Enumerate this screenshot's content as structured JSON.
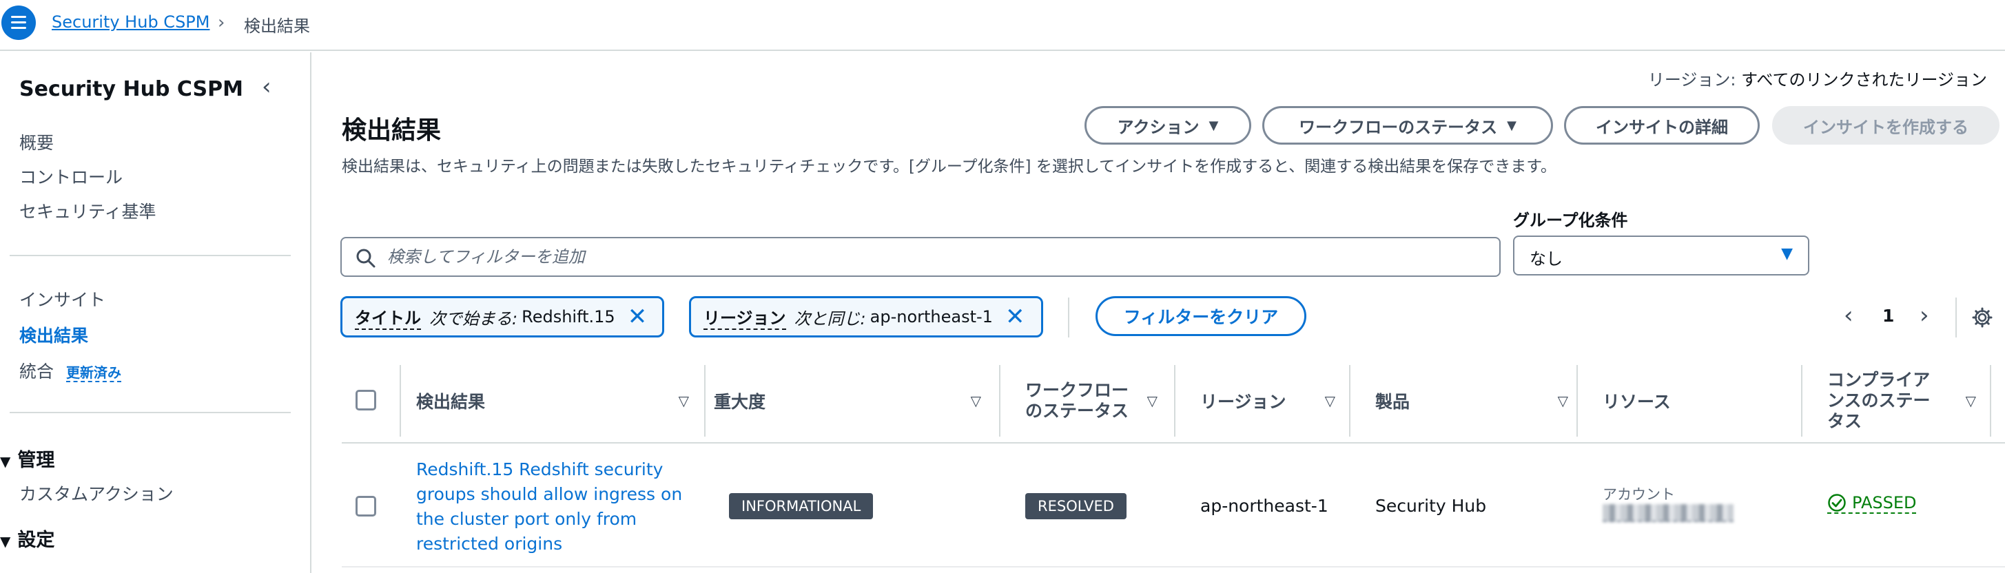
{
  "breadcrumb": {
    "service": "Security Hub CSPM",
    "current": "検出結果"
  },
  "sidebar": {
    "title": "Security Hub CSPM",
    "group1": [
      "概要",
      "コントロール",
      "セキュリティ基準"
    ],
    "group2": {
      "insights": "インサイト",
      "findings": "検出結果",
      "integrations": "統合",
      "integrations_badge": "更新済み"
    },
    "management": {
      "heading": "管理",
      "custom_actions": "カスタムアクション"
    },
    "settings": {
      "heading": "設定"
    }
  },
  "region": {
    "label": "リージョン:",
    "value": "すべてのリンクされたリージョン"
  },
  "page": {
    "title": "検出結果",
    "description": "検出結果は、セキュリティ上の問題または失敗したセキュリティチェックです。[グループ化条件] を選択してインサイトを作成すると、関連する検出結果を保存できます。"
  },
  "actions": {
    "action": "アクション",
    "workflow_status": "ワークフローのステータス",
    "insight_details": "インサイトの詳細",
    "create_insight": "インサイトを作成する"
  },
  "search": {
    "placeholder": "検索してフィルターを追加"
  },
  "group_by": {
    "label": "グループ化条件",
    "value": "なし"
  },
  "filters": [
    {
      "field": "タイトル",
      "operator": "次で始まる:",
      "value": "Redshift.15"
    },
    {
      "field": "リージョン",
      "operator": "次と同じ:",
      "value": "ap-northeast-1"
    }
  ],
  "clear_filters": "フィルターをクリア",
  "pagination": {
    "page": "1"
  },
  "table": {
    "columns": {
      "finding": "検出結果",
      "severity": "重大度",
      "workflow_status_l1": "ワークフロー",
      "workflow_status_l2": "のステータス",
      "region": "リージョン",
      "product": "製品",
      "resource": "リソース",
      "compliance_l1": "コンプライア",
      "compliance_l2": "ンスのステー",
      "compliance_l3": "タス"
    },
    "rows": [
      {
        "finding": "Redshift.15 Redshift security groups should allow ingress on the cluster port only from restricted origins",
        "severity": "INFORMATIONAL",
        "workflow_status": "RESOLVED",
        "region": "ap-northeast-1",
        "product": "Security Hub",
        "resource_label": "アカウント",
        "compliance": "PASSED"
      }
    ]
  },
  "colors": {
    "link": "#0972d3",
    "text": "#0f141a",
    "muted": "#414d5c",
    "badge_bg": "#414d5c",
    "passed": "#037f0c",
    "border": "#d5dbdb"
  },
  "icons": [
    "menu-icon",
    "chevron-right-icon",
    "chevron-left-icon",
    "caret-down-icon",
    "search-icon",
    "close-icon",
    "settings-gear-icon",
    "check-circle-icon",
    "sort-icon"
  ]
}
